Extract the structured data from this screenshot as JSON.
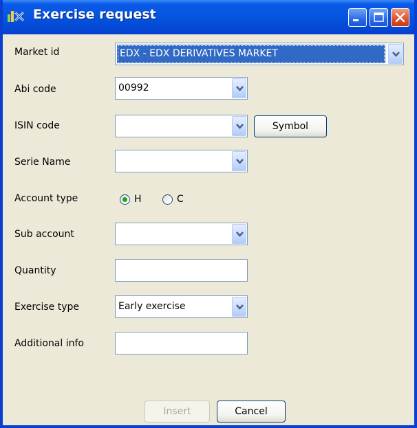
{
  "window": {
    "title": "Exercise request"
  },
  "form": {
    "market_id": {
      "label": "Market id",
      "value": "EDX -  EDX DERIVATIVES MARKET"
    },
    "abi_code": {
      "label": "Abi code",
      "value": "00992"
    },
    "isin_code": {
      "label": "ISIN code",
      "value": ""
    },
    "symbol_button": "Symbol",
    "serie_name": {
      "label": "Serie Name",
      "value": ""
    },
    "account_type": {
      "label": "Account type",
      "options": [
        "H",
        "C"
      ],
      "selected": "H"
    },
    "sub_account": {
      "label": "Sub account",
      "value": ""
    },
    "quantity": {
      "label": "Quantity",
      "value": ""
    },
    "exercise_type": {
      "label": "Exercise type",
      "value": "Early exercise"
    },
    "additional_info": {
      "label": "Additional info",
      "value": ""
    }
  },
  "buttons": {
    "insert": "Insert",
    "cancel": "Cancel"
  },
  "colors": {
    "titlebar": "#0556e0",
    "window_bg": "#ece9d8",
    "selection": "#316ac5"
  }
}
